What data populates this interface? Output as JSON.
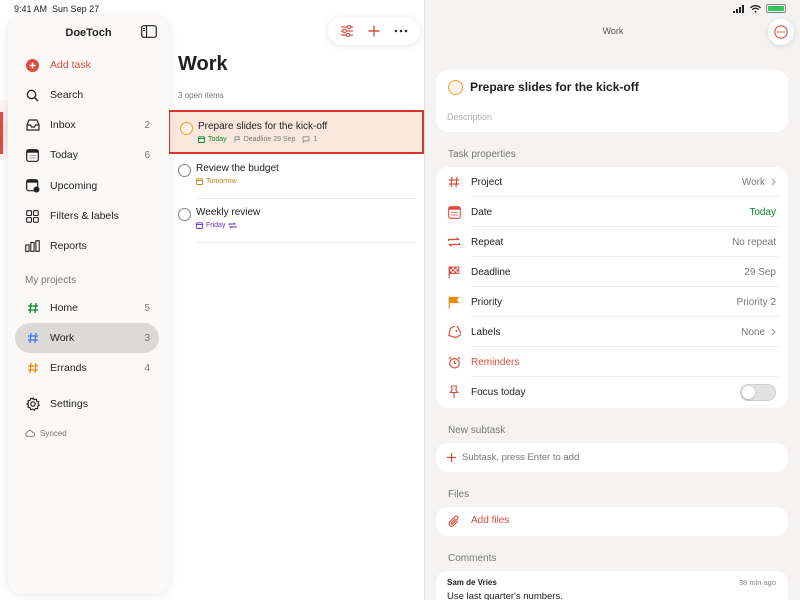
{
  "status_bar": {
    "time": "9:41 AM",
    "date": "Sun Sep 27"
  },
  "sidebar": {
    "app_name": "DoeToch",
    "add_task": "Add task",
    "items": [
      {
        "label": "Search",
        "icon": "search-icon"
      },
      {
        "label": "Inbox",
        "count": "2",
        "icon": "inbox-icon"
      },
      {
        "label": "Today",
        "count": "6",
        "icon": "calendar-today-icon"
      },
      {
        "label": "Upcoming",
        "icon": "calendar-upcoming-icon"
      },
      {
        "label": "Filters & labels",
        "icon": "filters-icon"
      },
      {
        "label": "Reports",
        "icon": "reports-icon"
      }
    ],
    "projects_heading": "My projects",
    "projects": [
      {
        "label": "Home",
        "count": "5",
        "color": "#058527"
      },
      {
        "label": "Work",
        "count": "3",
        "color": "#4073ff"
      },
      {
        "label": "Errands",
        "count": "4",
        "color": "#eb8909"
      }
    ],
    "settings": "Settings",
    "synced": "Synced"
  },
  "list": {
    "title": "Work",
    "open_items": "3 open items",
    "tasks": [
      {
        "title": "Prepare slides for the kick-off",
        "date": "Today",
        "deadline": "Deadline 29 Sep",
        "comments": "1"
      },
      {
        "title": "Review the budget",
        "date": "Tomorrow"
      },
      {
        "title": "Weekly review",
        "date": "Friday"
      }
    ]
  },
  "detail": {
    "project_name": "Work",
    "task_title": "Prepare slides for the kick-off",
    "description_placeholder": "Description",
    "properties_heading": "Task properties",
    "properties": {
      "project": {
        "label": "Project",
        "value": "Work"
      },
      "date": {
        "label": "Date",
        "value": "Today"
      },
      "repeat": {
        "label": "Repeat",
        "value": "No repeat"
      },
      "deadline": {
        "label": "Deadline",
        "value": "29 Sep"
      },
      "priority": {
        "label": "Priority",
        "value": "Priority 2"
      },
      "labels": {
        "label": "Labels",
        "value": "None"
      },
      "reminders": {
        "label": "Reminders"
      },
      "focus": {
        "label": "Focus today",
        "on": false
      }
    },
    "subtask_heading": "New subtask",
    "subtask_placeholder": "Subtask, press Enter to add",
    "files_heading": "Files",
    "add_files": "Add files",
    "comments_heading": "Comments",
    "comment": {
      "author": "Sam de Vries",
      "time": "38 min ago",
      "text": "Use last quarter's numbers."
    }
  },
  "colors": {
    "accent": "#dc4c3e",
    "today_green": "#058527",
    "priority2": "#eb8909"
  }
}
